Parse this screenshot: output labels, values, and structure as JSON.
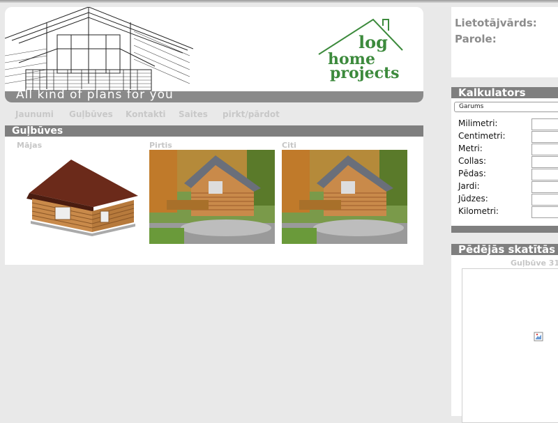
{
  "header": {
    "slogan": "All kind of plans for you",
    "logo_line1": "log",
    "logo_line2": "home",
    "logo_line3": "projects"
  },
  "nav": {
    "items": [
      "Jaunumi",
      "Guļbūves",
      "Kontakti",
      "Saites",
      "pirkt/pārdot"
    ]
  },
  "section": {
    "title": "Guļbūves",
    "categories": [
      "Mājas",
      "Pirtis",
      "Citi"
    ]
  },
  "login": {
    "username_label": "Lietotājvārds:",
    "password_label": "Parole:"
  },
  "calculator": {
    "title": "Kalkulators",
    "selected": "Garums",
    "units": [
      "Milimetri:",
      "Centimetri:",
      "Metri:",
      "Collas:",
      "Pēdas:",
      "Jardi:",
      "Jūdzes:",
      "Kilometri:"
    ]
  },
  "recent": {
    "title": "Pēdējās skatītās",
    "item_title": "Guļbūve 31"
  },
  "colors": {
    "page_bg": "#e9e9e9",
    "bar_gray": "#7f7f7f",
    "logo_green": "#3c8a3c",
    "muted_text": "#c6c6c6"
  }
}
